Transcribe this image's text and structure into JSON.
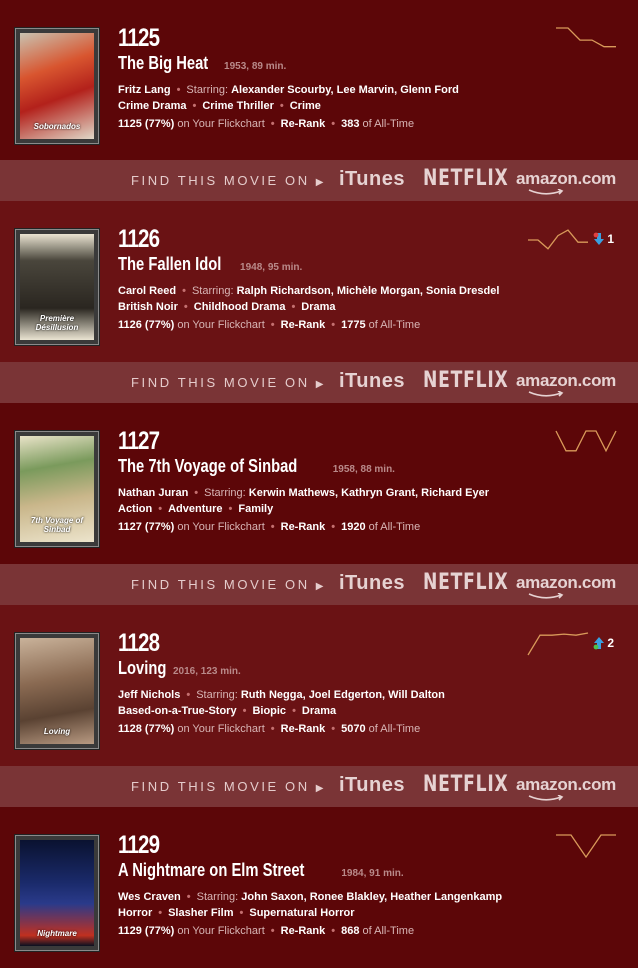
{
  "find_bar": {
    "label": "FIND THIS MOVIE ON",
    "arrow": "▶",
    "itunes": "iTunes",
    "netflix": "NETFLIX",
    "amazon": "amazon.com"
  },
  "movies": [
    {
      "rank": "1125",
      "title": "The Big Heat",
      "meta": "1953, 89 min.",
      "director": "Fritz Lang",
      "starring_label": "Starring:",
      "starring": "Alexander Scourby, Lee Marvin, Glenn Ford",
      "genres": [
        "Crime Drama",
        "Crime Thriller",
        "Crime"
      ],
      "flickchart": "1125 (77%)",
      "flickchart_suffix": "on Your Flickchart",
      "rerank": "Re-Rank",
      "alltime": "383",
      "alltime_suffix": "of All-Time",
      "movement": "",
      "movement_dir": "none",
      "sparkline": [
        0.0,
        0.0,
        0.55,
        0.55,
        0.85,
        0.85
      ],
      "poster_title": "Sobornados"
    },
    {
      "rank": "1126",
      "title": "The Fallen Idol",
      "meta": "1948, 95 min.",
      "director": "Carol Reed",
      "starring_label": "Starring:",
      "starring": "Ralph Richardson, Michèle Morgan, Sonia Dresdel",
      "genres": [
        "British Noir",
        "Childhood Drama",
        "Drama"
      ],
      "flickchart": "1126 (77%)",
      "flickchart_suffix": "on Your Flickchart",
      "rerank": "Re-Rank",
      "alltime": "1775",
      "alltime_suffix": "of All-Time",
      "movement": "1",
      "movement_dir": "down",
      "sparkline": [
        0.5,
        0.5,
        0.9,
        0.3,
        0.05,
        0.6,
        0.6
      ],
      "poster_title": "Première Désillusion"
    },
    {
      "rank": "1127",
      "title": "The 7th Voyage of Sinbad",
      "meta": "1958, 88 min.",
      "director": "Nathan Juran",
      "starring_label": "Starring:",
      "starring": "Kerwin Mathews, Kathryn Grant, Richard Eyer",
      "genres": [
        "Action",
        "Adventure",
        "Family"
      ],
      "flickchart": "1127 (77%)",
      "flickchart_suffix": "on Your Flickchart",
      "rerank": "Re-Rank",
      "alltime": "1920",
      "alltime_suffix": "of All-Time",
      "movement": "",
      "movement_dir": "none",
      "sparkline": [
        0.0,
        0.9,
        0.9,
        0.0,
        0.0,
        0.9,
        0.0
      ],
      "poster_title": "7th Voyage of Sinbad"
    },
    {
      "rank": "1128",
      "title": "Loving",
      "meta": "2016, 123 min.",
      "director": "Jeff Nichols",
      "starring_label": "Starring:",
      "starring": "Ruth Negga, Joel Edgerton, Will Dalton",
      "genres": [
        "Based-on-a-True-Story",
        "Biopic",
        "Drama"
      ],
      "flickchart": "1128 (77%)",
      "flickchart_suffix": "on Your Flickchart",
      "rerank": "Re-Rank",
      "alltime": "5070",
      "alltime_suffix": "of All-Time",
      "movement": "2",
      "movement_dir": "up",
      "sparkline": [
        1.0,
        0.1,
        0.1,
        0.05,
        0.1,
        0.0
      ],
      "poster_title": "Loving"
    },
    {
      "rank": "1129",
      "title": "A Nightmare on Elm Street",
      "meta": "1984, 91 min.",
      "director": "Wes Craven",
      "starring_label": "Starring:",
      "starring": "John Saxon, Ronee Blakley, Heather Langenkamp",
      "genres": [
        "Horror",
        "Slasher Film",
        "Supernatural Horror"
      ],
      "flickchart": "1129 (77%)",
      "flickchart_suffix": "on Your Flickchart",
      "rerank": "Re-Rank",
      "alltime": "868",
      "alltime_suffix": "of All-Time",
      "movement": "",
      "movement_dir": "none",
      "sparkline": [
        0.0,
        0.0,
        1.0,
        0.0,
        0.0
      ],
      "poster_title": "Nightmare"
    }
  ]
}
